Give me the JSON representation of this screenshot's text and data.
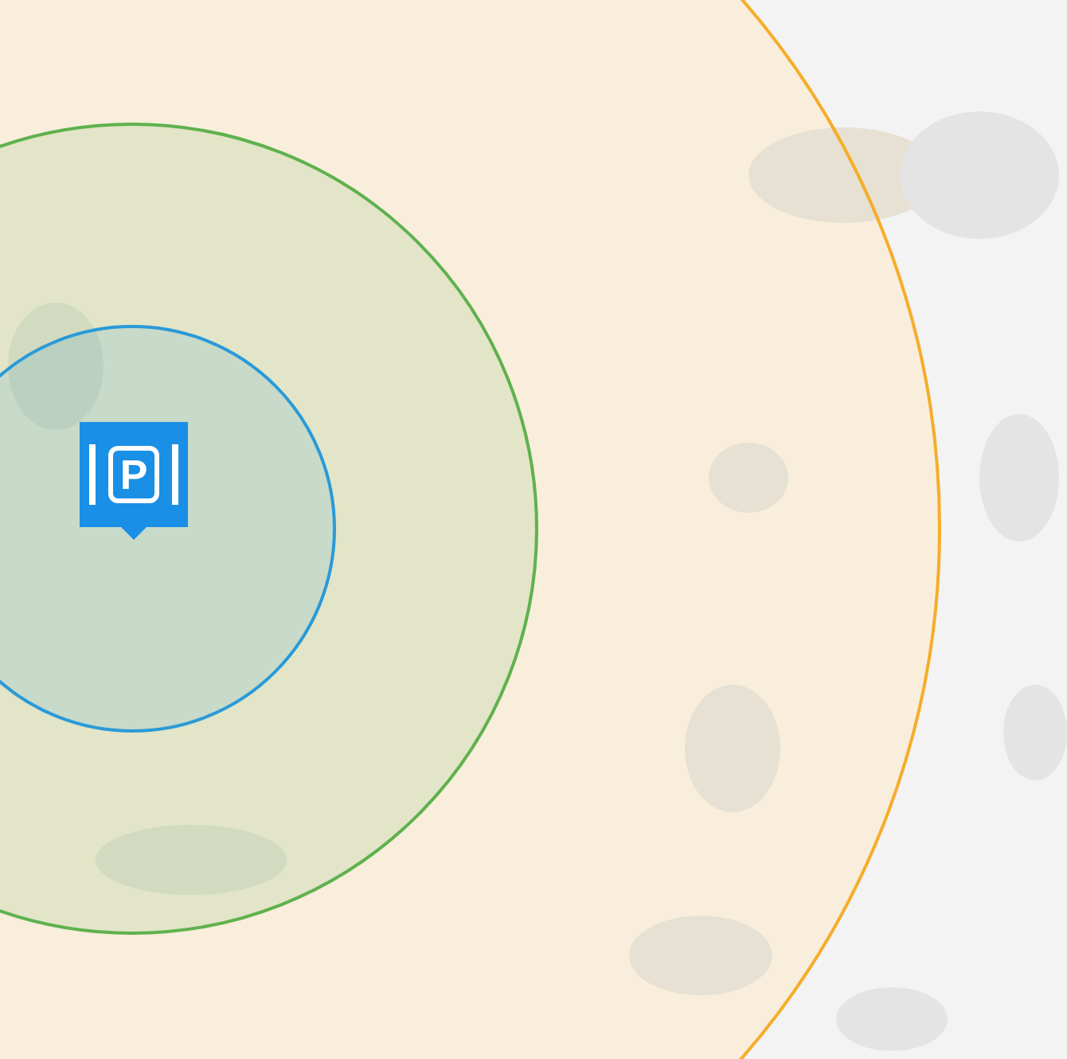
{
  "map": {
    "zones": [
      {
        "kind": "large",
        "color": "#f6ad2a"
      },
      {
        "kind": "medium",
        "color": "#5fb14e"
      },
      {
        "kind": "small",
        "color": "#2a9ad8"
      }
    ],
    "marker": {
      "label": "P"
    }
  }
}
